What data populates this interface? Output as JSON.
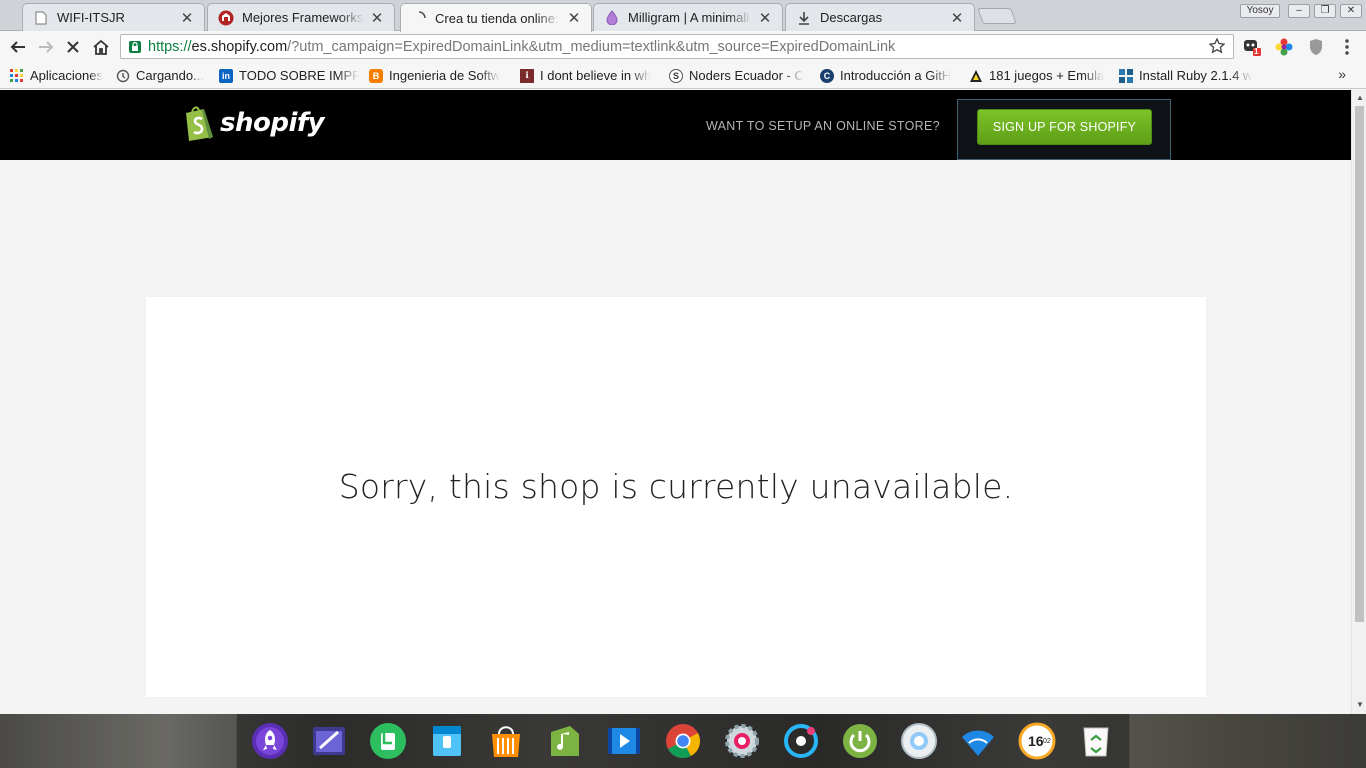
{
  "tabs": [
    {
      "title": "WIFI-ITSJR",
      "icon": "page-icon"
    },
    {
      "title": "Mejores Frameworks C",
      "icon": "frameworks-favicon"
    },
    {
      "title": "Crea tu tienda online:",
      "icon": "loading-spinner"
    },
    {
      "title": "Milligram | A minimali",
      "icon": "milligram-favicon"
    },
    {
      "title": "Descargas",
      "icon": "download-icon"
    }
  ],
  "window": {
    "profile": "Yosoy"
  },
  "address_bar": {
    "scheme": "https://",
    "domain": "es.shopify.com",
    "path": "/?utm_campaign=ExpiredDomainLink&utm_medium=textlink&utm_source=ExpiredDomainLink"
  },
  "extensions": {
    "badge": "1"
  },
  "bookmarks": [
    {
      "label": "Aplicaciones",
      "icon": "apps-grid-icon"
    },
    {
      "label": "Cargando...",
      "icon": "history-icon"
    },
    {
      "label": "TODO SOBRE IMPRE",
      "icon": "linkedin-icon"
    },
    {
      "label": "Ingenieria de Softw",
      "icon": "blogger-icon"
    },
    {
      "label": "I dont believe in wh",
      "icon": "site-favicon"
    },
    {
      "label": "Noders Ecuador - C",
      "icon": "noders-icon"
    },
    {
      "label": "Introducción a GitH",
      "icon": "codigo-facilito-icon"
    },
    {
      "label": "181 juegos + Emula",
      "icon": "juegos-icon"
    },
    {
      "label": "Install Ruby 2.1.4 w",
      "icon": "ruby-icon"
    }
  ],
  "shopify": {
    "logo_text": "shopify",
    "setup_question": "WANT TO SETUP AN ONLINE STORE?",
    "signup_label": "SIGN UP FOR SHOPIFY",
    "brand_green": "#6fb324",
    "message": "Sorry, this shop is currently unavailable."
  },
  "dock": {
    "items": [
      "launcher-icon",
      "text-editor-icon",
      "evernote-icon",
      "files-icon",
      "store-icon",
      "music-icon",
      "video-icon",
      "chrome-icon",
      "settings-icon",
      "deepin-icon",
      "power-icon",
      "screenshot-icon",
      "wifi-icon",
      "clock-icon",
      "trash-icon"
    ],
    "clock_text": "16",
    "clock_minutes": "02"
  }
}
